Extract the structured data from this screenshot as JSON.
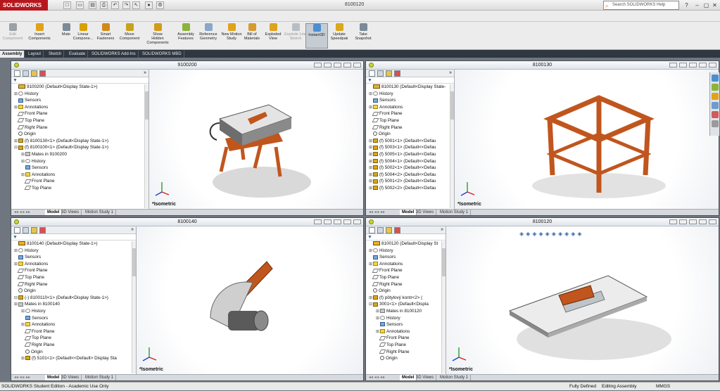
{
  "app": {
    "logo": "SOLIDWORKS",
    "title": "8100120",
    "search_placeholder": "Search SOLIDWORKS Help"
  },
  "quick_access": [
    "new-icon",
    "open-icon",
    "save-icon",
    "print-icon",
    "undo-icon",
    "redo-icon",
    "select-icon",
    "rebuild-icon",
    "options-icon"
  ],
  "commands": [
    {
      "label": "Edit Component",
      "state": "disabled",
      "icon": "edit-component-icon",
      "color": "#9aa0a6"
    },
    {
      "label": "Insert Components",
      "state": "normal",
      "icon": "insert-components-icon",
      "color": "#e0a21c"
    },
    {
      "label": "Mate",
      "state": "normal",
      "icon": "mate-icon",
      "color": "#7a8a99"
    },
    {
      "label": "Linear Compone...",
      "state": "normal",
      "icon": "linear-pattern-icon",
      "color": "#d9a000"
    },
    {
      "label": "Smart Fasteners",
      "state": "normal",
      "icon": "smart-fasteners-icon",
      "color": "#d08a1a"
    },
    {
      "label": "Move Component",
      "state": "normal",
      "icon": "move-component-icon",
      "color": "#c9a21c"
    },
    {
      "label": "Show Hidden Components",
      "state": "normal",
      "icon": "show-hidden-icon",
      "color": "#d39b1b"
    },
    {
      "label": "Assembly Features",
      "state": "normal",
      "icon": "assembly-features-icon",
      "color": "#8ab43a"
    },
    {
      "label": "Reference Geometry",
      "state": "normal",
      "icon": "reference-geometry-icon",
      "color": "#8aa7c9"
    },
    {
      "label": "New Motion Study",
      "state": "normal",
      "icon": "motion-study-icon",
      "color": "#e0a21c"
    },
    {
      "label": "Bill of Materials",
      "state": "normal",
      "icon": "bom-icon",
      "color": "#d59a30"
    },
    {
      "label": "Exploded View",
      "state": "normal",
      "icon": "exploded-view-icon",
      "color": "#e0a21c"
    },
    {
      "label": "Explode Line Sketch",
      "state": "disabled",
      "icon": "explode-line-icon",
      "color": "#b9bec4"
    },
    {
      "label": "Instant3D",
      "state": "active",
      "icon": "instant3d-icon",
      "color": "#4b8fd0"
    },
    {
      "label": "Update Speedpak",
      "state": "normal",
      "icon": "speedpak-icon",
      "color": "#d9a81c"
    },
    {
      "label": "Take Snapshot",
      "state": "normal",
      "icon": "snapshot-icon",
      "color": "#7a8a99"
    }
  ],
  "tabs": [
    "Assembly",
    "Layout",
    "Sketch",
    "Evaluate",
    "SOLIDWORKS Add-Ins",
    "SOLIDWORKS MBD"
  ],
  "windows": [
    {
      "title": "9100200",
      "tree": [
        {
          "t": "9100200  (Default<Display State-1>)",
          "i": "root",
          "ex": ""
        },
        {
          "t": "History",
          "i": "hist",
          "ex": "+"
        },
        {
          "t": "Sensors",
          "i": "sens",
          "ex": ""
        },
        {
          "t": "Annotations",
          "i": "ann",
          "ex": "+"
        },
        {
          "t": "Front Plane",
          "i": "plane",
          "ex": ""
        },
        {
          "t": "Top Plane",
          "i": "plane",
          "ex": ""
        },
        {
          "t": "Right Plane",
          "i": "plane",
          "ex": ""
        },
        {
          "t": "Origin",
          "i": "orig",
          "ex": ""
        },
        {
          "t": "(f) 8100130<1> (Default<Display State-1>)",
          "i": "asm",
          "ex": "+"
        },
        {
          "t": "(f) 8100100<1> (Default<Display State-1>)",
          "i": "asm",
          "ex": "-"
        },
        {
          "t": "Mates in 9100200",
          "i": "mate",
          "ex": "+"
        },
        {
          "t": "History",
          "i": "hist",
          "ex": "+"
        },
        {
          "t": "Sensors",
          "i": "sens",
          "ex": ""
        },
        {
          "t": "Annotations",
          "i": "ann",
          "ex": "+"
        },
        {
          "t": "Front Plane",
          "i": "plane",
          "ex": ""
        },
        {
          "t": "Top Plane",
          "i": "plane",
          "ex": ""
        }
      ],
      "view": "*Isometric"
    },
    {
      "title": "8100130",
      "tree": [
        {
          "t": "8100130  (Default<Display State-",
          "i": "root",
          "ex": ""
        },
        {
          "t": "History",
          "i": "hist",
          "ex": "+"
        },
        {
          "t": "Sensors",
          "i": "sens",
          "ex": ""
        },
        {
          "t": "Annotations",
          "i": "ann",
          "ex": "+"
        },
        {
          "t": "Front Plane",
          "i": "plane",
          "ex": ""
        },
        {
          "t": "Top Plane",
          "i": "plane",
          "ex": ""
        },
        {
          "t": "Right Plane",
          "i": "plane",
          "ex": ""
        },
        {
          "t": "Origin",
          "i": "orig",
          "ex": ""
        },
        {
          "t": "(f) 5001<1> (Default<<Defau",
          "i": "asm",
          "ex": "+"
        },
        {
          "t": "(f) 5003<1> (Default<<Defau",
          "i": "asm",
          "ex": "+"
        },
        {
          "t": "(f) 5005<1> (Default<<Defau",
          "i": "asm",
          "ex": "+"
        },
        {
          "t": "(f) 5004<1> (Default<<Defau",
          "i": "asm",
          "ex": "+"
        },
        {
          "t": "(f) 5002<1> (Default<<Defau",
          "i": "asm",
          "ex": "+"
        },
        {
          "t": "(f) 5004<2> (Default<<Defau",
          "i": "asm",
          "ex": "+"
        },
        {
          "t": "(f) 5001<2> (Default<<Defau",
          "i": "asm",
          "ex": "+"
        },
        {
          "t": "(f) 5002<2> (Default<<Defau",
          "i": "asm",
          "ex": "+"
        }
      ],
      "view": "*Isometric"
    },
    {
      "title": "8100140",
      "tree": [
        {
          "t": "8100140  (Default<Display State-1>)",
          "i": "root",
          "ex": ""
        },
        {
          "t": "History",
          "i": "hist",
          "ex": "+"
        },
        {
          "t": "Sensors",
          "i": "sens",
          "ex": ""
        },
        {
          "t": "Annotations",
          "i": "ann",
          "ex": "+"
        },
        {
          "t": "Front Plane",
          "i": "plane",
          "ex": ""
        },
        {
          "t": "Top Plane",
          "i": "plane",
          "ex": ""
        },
        {
          "t": "Right Plane",
          "i": "plane",
          "ex": ""
        },
        {
          "t": "Origin",
          "i": "orig",
          "ex": ""
        },
        {
          "t": "(-) 8100110<1> (Default<Display State-1>)",
          "i": "asm",
          "ex": "-"
        },
        {
          "t": "Mates in 8100140",
          "i": "mate",
          "ex": "+"
        },
        {
          "t": "History",
          "i": "hist",
          "ex": "+"
        },
        {
          "t": "Sensors",
          "i": "sens",
          "ex": ""
        },
        {
          "t": "Annotations",
          "i": "ann",
          "ex": "+"
        },
        {
          "t": "Front Plane",
          "i": "plane",
          "ex": ""
        },
        {
          "t": "Top Plane",
          "i": "plane",
          "ex": ""
        },
        {
          "t": "Right Plane",
          "i": "plane",
          "ex": ""
        },
        {
          "t": "Origin",
          "i": "orig",
          "ex": ""
        },
        {
          "t": "(f) 5101<1> (Default<<Default> Display Sta",
          "i": "asm",
          "ex": "+"
        }
      ],
      "view": "*Isometric"
    },
    {
      "title": "8100120",
      "tree": [
        {
          "t": "8100120  (Default<Display St",
          "i": "root",
          "ex": ""
        },
        {
          "t": "History",
          "i": "hist",
          "ex": "+"
        },
        {
          "t": "Sensors",
          "i": "sens",
          "ex": ""
        },
        {
          "t": "Annotations",
          "i": "ann",
          "ex": "+"
        },
        {
          "t": "Front Plane",
          "i": "plane",
          "ex": ""
        },
        {
          "t": "Top Plane",
          "i": "plane",
          "ex": ""
        },
        {
          "t": "Right Plane",
          "i": "plane",
          "ex": ""
        },
        {
          "t": "Origin",
          "i": "orig",
          "ex": ""
        },
        {
          "t": "(f) pôtylový kontr<2> (",
          "i": "asm",
          "ex": "+"
        },
        {
          "t": "3001<1> (Default<Displa",
          "i": "asm",
          "ex": "-"
        },
        {
          "t": "Mates in 8100120",
          "i": "mate",
          "ex": "+"
        },
        {
          "t": "History",
          "i": "hist",
          "ex": "+"
        },
        {
          "t": "Sensors",
          "i": "sens",
          "ex": ""
        },
        {
          "t": "Annotations",
          "i": "ann",
          "ex": "+"
        },
        {
          "t": "Front Plane",
          "i": "plane",
          "ex": ""
        },
        {
          "t": "Top Plane",
          "i": "plane",
          "ex": ""
        },
        {
          "t": "Right Plane",
          "i": "plane",
          "ex": ""
        },
        {
          "t": "Origin",
          "i": "orig",
          "ex": ""
        }
      ],
      "view": "*Isometric"
    }
  ],
  "bottom_tabs": [
    "Model",
    "3D Views",
    "Motion Study 1"
  ],
  "status": {
    "left": "SOLIDWORKS Student Edition - Academic Use Only",
    "defined": "Fully Defined",
    "mode": "Editing Assembly",
    "units": "MMGS"
  },
  "colors": {
    "wood": "#c0561e",
    "part_gray": "#7d7d7d",
    "sw_red": "#b8161d"
  }
}
